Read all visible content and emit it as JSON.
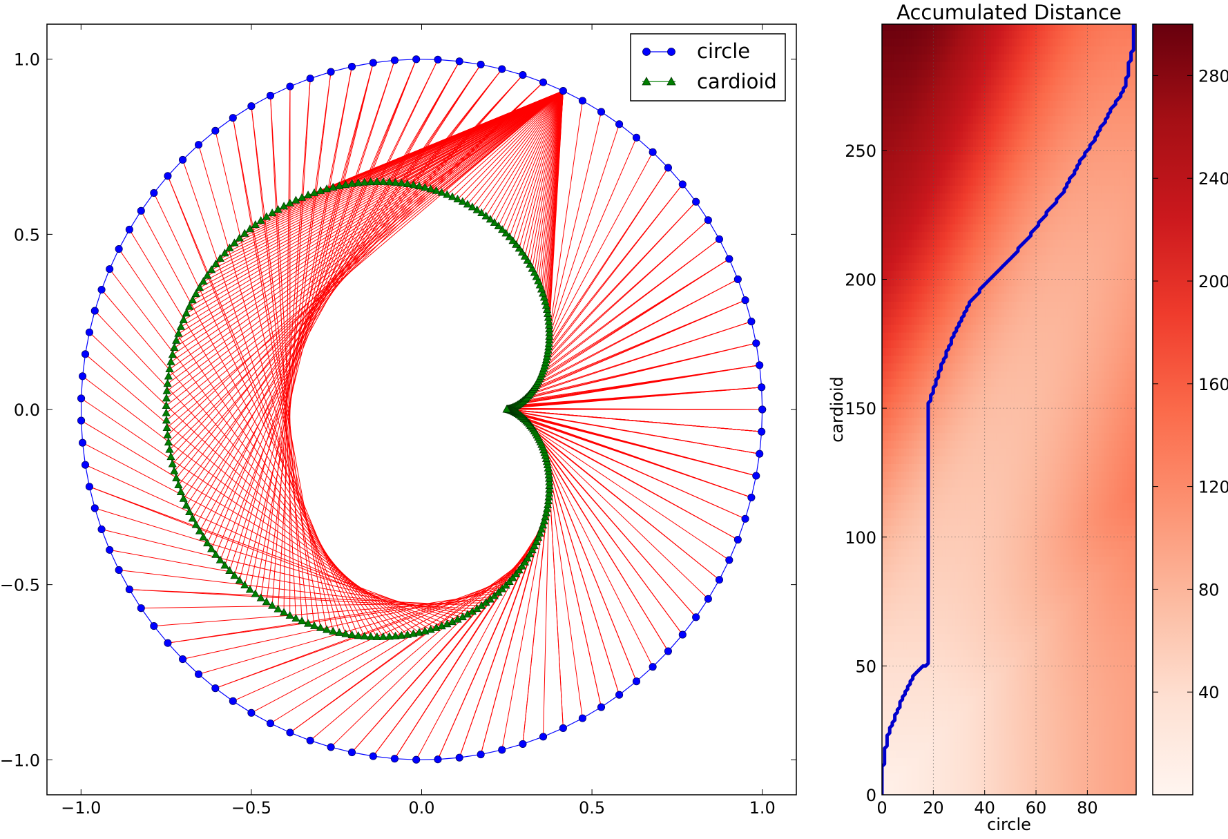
{
  "chart_data": [
    {
      "type": "line",
      "title": "",
      "xlabel": "",
      "ylabel": "",
      "xlim": [
        -1.1,
        1.1
      ],
      "ylim": [
        -1.1,
        1.1
      ],
      "xticks": [
        -1.0,
        -0.5,
        0.0,
        0.5,
        1.0
      ],
      "yticks": [
        -1.0,
        -0.5,
        0.0,
        0.5,
        1.0
      ],
      "xtick_labels": [
        "−1.0",
        "−0.5",
        "0.0",
        "0.5",
        "1.0"
      ],
      "ytick_labels": [
        "−1.0",
        "−0.5",
        "0.0",
        "0.5",
        "1.0"
      ],
      "series": [
        {
          "name": "circle",
          "color": "#0000ff",
          "marker": "circle",
          "curve": "x = cos(t), y = sin(t)",
          "n_points": 100
        },
        {
          "name": "cardioid",
          "color": "#007f00",
          "marker": "triangle",
          "curve": "r = 0.5*(1 - cos(t)) - 0.25 (shifted), x = r*cos(t), y = r*sin(t)",
          "n_points": 300
        }
      ],
      "alignment_lines": {
        "color": "#ff0000",
        "description": "warping path connecting matched circle and cardioid points"
      },
      "legend": {
        "placement": "top-right",
        "entries": [
          "circle",
          "cardioid"
        ]
      },
      "grid": false
    },
    {
      "type": "heatmap",
      "title": "Accumulated Distance",
      "xlabel": "circle",
      "ylabel": "cardioid",
      "xlim": [
        0,
        99
      ],
      "ylim": [
        0,
        299
      ],
      "xticks": [
        0,
        20,
        40,
        60,
        80
      ],
      "yticks": [
        0,
        50,
        100,
        150,
        200,
        250
      ],
      "colormap": "Reds",
      "grid": true,
      "colorbar": {
        "min": 0,
        "max": 300,
        "ticks": [
          40,
          80,
          120,
          160,
          200,
          240,
          280
        ]
      },
      "warping_path": {
        "color": "#0000cc",
        "x": [
          0,
          0,
          1,
          2,
          3,
          5,
          7,
          9,
          11,
          13,
          15,
          17,
          18,
          18,
          18,
          18,
          20,
          23,
          27,
          31,
          35,
          40,
          45,
          50,
          55,
          60,
          65,
          70,
          74,
          78,
          82,
          86,
          88,
          92,
          95,
          96,
          97,
          98,
          98
        ],
        "y": [
          0,
          8,
          15,
          22,
          26,
          30,
          35,
          40,
          44,
          47,
          49,
          50,
          51,
          100,
          150,
          151,
          157,
          166,
          176,
          185,
          192,
          198,
          203,
          208,
          214,
          220,
          227,
          233,
          240,
          247,
          253,
          260,
          264,
          270,
          276,
          282,
          287,
          290,
          299
        ]
      }
    }
  ],
  "colors": {
    "circle": "#0000ff",
    "cardioid": "#007f00",
    "match_line": "#ff0000",
    "path": "#0000cc"
  }
}
